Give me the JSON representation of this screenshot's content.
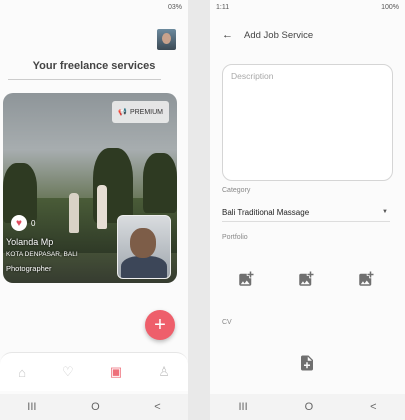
{
  "left": {
    "status": {
      "right": "03%"
    },
    "section_title": "Your freelance services",
    "card": {
      "badge": "PREMIUM",
      "likes": "0",
      "title": "Yolanda Mp",
      "location": "KOTA DENPASAR, BALI",
      "category": "Photographer"
    },
    "fab_label": "+",
    "nav_icons": [
      "home-icon",
      "heart-icon",
      "briefcase-icon",
      "profile-icon"
    ],
    "accent": "#ee5f6b"
  },
  "right": {
    "status": {
      "time": "1:11",
      "right": "100%"
    },
    "page_title": "Add Job Service",
    "description_placeholder": "Description",
    "category_label": "Category",
    "category_value": "Bali Traditional Massage",
    "portfolio_label": "Portfolio",
    "cv_label": "CV"
  },
  "sysnav": [
    "III",
    "O",
    "<"
  ]
}
